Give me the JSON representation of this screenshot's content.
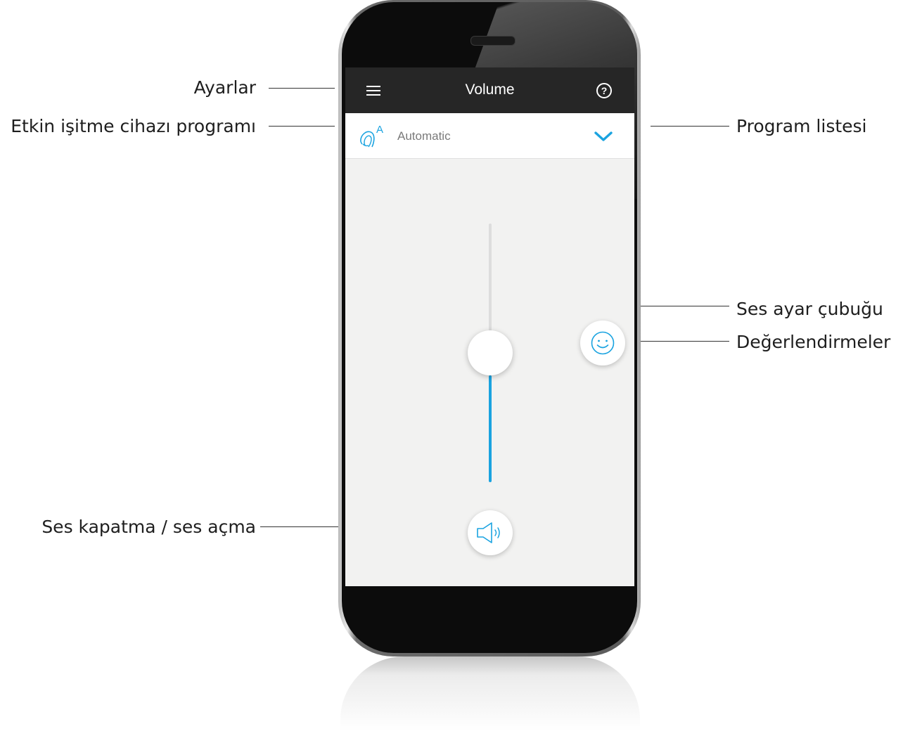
{
  "annotations": {
    "settings": "Ayarlar",
    "active_program": "Etkin işitme cihazı programı",
    "program_list": "Program listesi",
    "volume_slider": "Ses ayar çubuğu",
    "ratings": "Değerlendirmeler",
    "mute_toggle": "Ses kapatma / ses açma"
  },
  "app": {
    "title": "Volume",
    "help_symbol": "?",
    "program": {
      "name": "Automatic",
      "icon": "hearing-aid-icon",
      "badge": "A"
    },
    "volume_level": 0.42,
    "icons": {
      "menu": "hamburger-menu-icon",
      "help": "help-icon",
      "dropdown": "chevron-down-icon",
      "rating": "smiley-face-icon",
      "mute": "speaker-icon"
    }
  },
  "colors": {
    "accent": "#1aa3e0",
    "topbar": "#262626",
    "screen_bg": "#f2f2f1"
  }
}
